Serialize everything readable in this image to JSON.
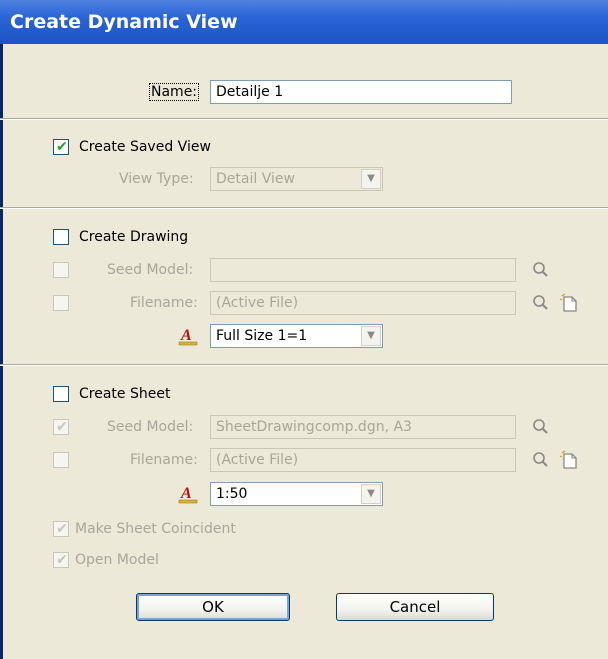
{
  "window": {
    "title": "Create Dynamic View"
  },
  "name": {
    "label": "Name:",
    "value": "Detailje 1"
  },
  "saved_view": {
    "checkbox_label": "Create Saved View",
    "checked": true,
    "view_type_label": "View Type:",
    "view_type_value": "Detail View"
  },
  "drawing": {
    "checkbox_label": "Create Drawing",
    "checked": false,
    "seed_model_label": "Seed Model:",
    "seed_model_value": "",
    "filename_label": "Filename:",
    "filename_value": "(Active File)",
    "scale_value": "Full Size 1=1"
  },
  "sheet": {
    "checkbox_label": "Create Sheet",
    "checked": false,
    "seed_model_label": "Seed Model:",
    "seed_model_value": "SheetDrawingcomp.dgn, A3",
    "filename_label": "Filename:",
    "filename_value": "(Active File)",
    "scale_value": "1:50",
    "make_coincident_label": "Make Sheet Coincident",
    "open_model_label": "Open Model"
  },
  "buttons": {
    "ok_label": "OK",
    "cancel_label": "Cancel"
  },
  "colors": {
    "title_bar": "#2a64d6",
    "dialog_bg": "#ece9d8",
    "check_green": "#21a121",
    "disabled_text": "#a8a69c"
  },
  "icons": [
    "magnifier-icon",
    "new-file-icon",
    "annotation-scale-icon",
    "checkmark-icon",
    "dropdown-arrow-icon"
  ]
}
